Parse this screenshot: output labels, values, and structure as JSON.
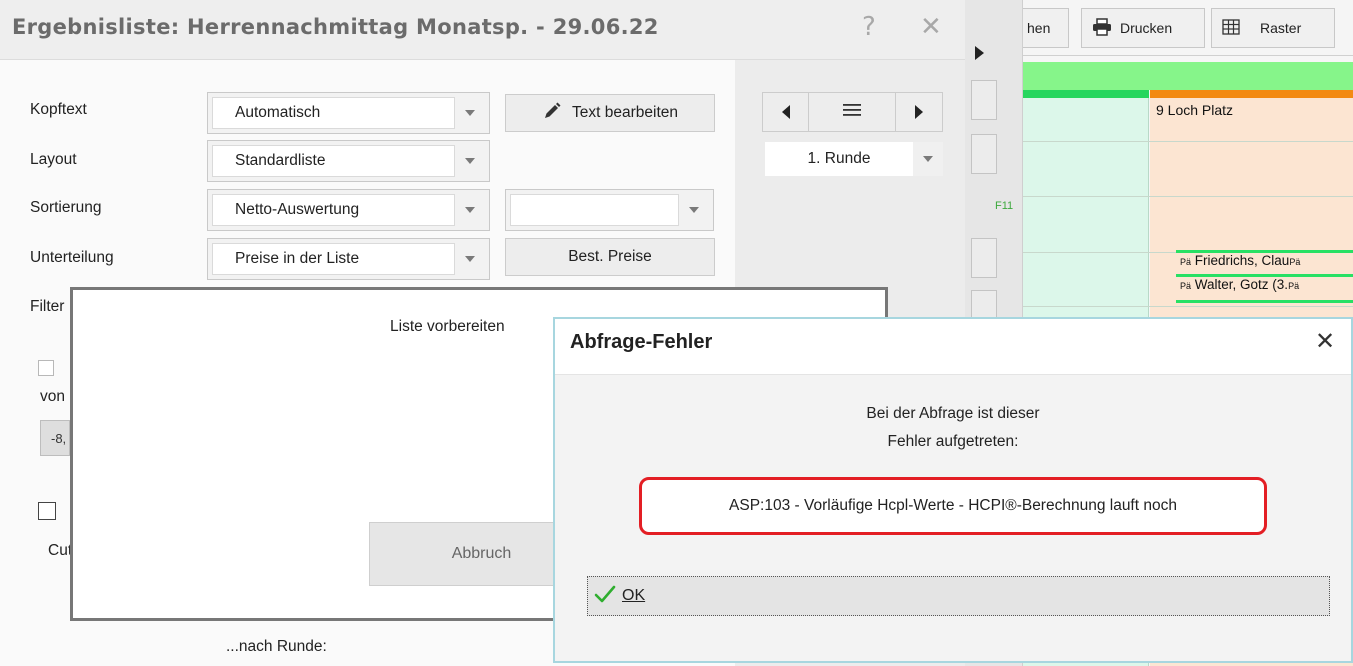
{
  "background_app": {
    "toolbar": {
      "partial_button_label": "hen",
      "print_label": "Drucken",
      "grid_label": "Raster"
    },
    "strip_hotkey": "F11",
    "course_label": "9 Loch Platz",
    "players": [
      {
        "prefix": "Pä",
        "name": "Friedrichs, Clau",
        "suffix": "Pä"
      },
      {
        "prefix": "Pä",
        "name": "Walter, Gotz (3.",
        "suffix": "Pä"
      }
    ]
  },
  "main_dialog": {
    "title": "Ergebnisliste: Herrennachmittag Monatsp. - 29.06.22",
    "help_glyph": "?",
    "close_glyph": "✕",
    "fields": {
      "kopftext_label": "Kopftext",
      "kopftext_value": "Automatisch",
      "layout_label": "Layout",
      "layout_value": "Standardliste",
      "sortierung_label": "Sortierung",
      "sortierung_value": "Netto-Auswertung",
      "sortierung_secondary_value": "",
      "unterteilung_label": "Unterteilung",
      "unterteilung_value": "Preise in der Liste",
      "filter_label": "Filter",
      "von_label": "von",
      "von_value": "-8,",
      "cut_label": "Cut"
    },
    "buttons": {
      "text_edit": "Text bearbeiten",
      "best_prices": "Best. Preise"
    },
    "round_select": "1. Runde",
    "after_round_label": "...nach Runde:"
  },
  "progress_dialog": {
    "message": "Liste vorbereiten",
    "abort_label": "Abbruch"
  },
  "error_dialog": {
    "title": "Abfrage-Fehler",
    "close_glyph": "✕",
    "message_line1": "Bei der Abfrage ist dieser",
    "message_line2": "Fehler aufgetreten:",
    "error_text": "ASP:103 - Vorläufige Hcpl-Werte - HCPI®-Berechnung lauft noch",
    "ok_label": "OK"
  },
  "colors": {
    "error_highlight": "#e31e24",
    "ok_check": "#2fae2f",
    "error_dialog_border": "#a7d6df",
    "band_green": "#86f58a",
    "orange": "#f38a12"
  }
}
